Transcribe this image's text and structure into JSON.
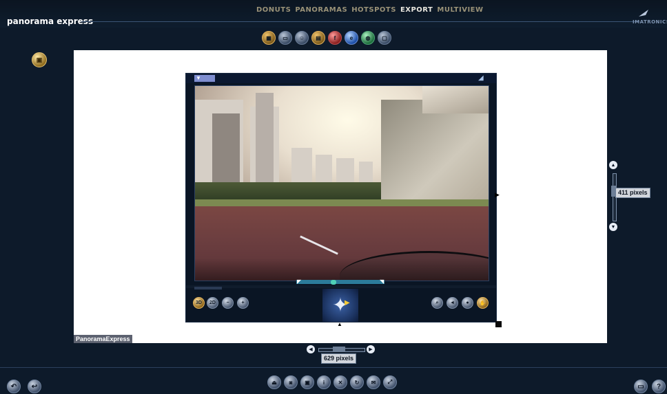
{
  "header": {
    "nav": [
      {
        "label": "DONUTS",
        "active": false
      },
      {
        "label": "PANORAMAS",
        "active": false
      },
      {
        "label": "HOTSPOTS",
        "active": false
      },
      {
        "label": "EXPORT",
        "active": true
      },
      {
        "label": "MULTIVIEW",
        "active": false
      }
    ],
    "app_title": "panorama express",
    "brand": "IMATRONICS"
  },
  "top_toolbar": {
    "icons": [
      "layout-icon",
      "window-icon",
      "person-icon",
      "folder-icon",
      "flash-icon",
      "ie-icon",
      "globe-icon",
      "window-frame-icon"
    ]
  },
  "viewer": {
    "controls_left": [
      "3D",
      "2D",
      "−",
      "+"
    ],
    "controls_right": [
      "magnify-icon",
      "speaker-icon",
      "sphere-icon",
      "hand-icon"
    ],
    "compass_glyph": "✦"
  },
  "canvas": {
    "label": "PanoramaExpress",
    "height_label": "411 pixels",
    "width_label": "629 pixels"
  },
  "bottom_toolbar": {
    "icons": [
      "exit-icon",
      "save-disk-icon",
      "floppy-icon",
      "info-icon",
      "tools-icon",
      "refresh-icon",
      "mail-icon",
      "fullscreen-icon"
    ]
  },
  "bottom_left": {
    "icons": [
      "undo-icon",
      "back-icon"
    ]
  },
  "bottom_right": {
    "icons": [
      "preview-window-icon",
      "help-icon"
    ],
    "help_glyph": "?"
  },
  "colors": {
    "background": "#0d1a2a",
    "canvas": "#ffffff",
    "active_nav": "#e9e7df",
    "accent_gold": "#e0b05a"
  }
}
